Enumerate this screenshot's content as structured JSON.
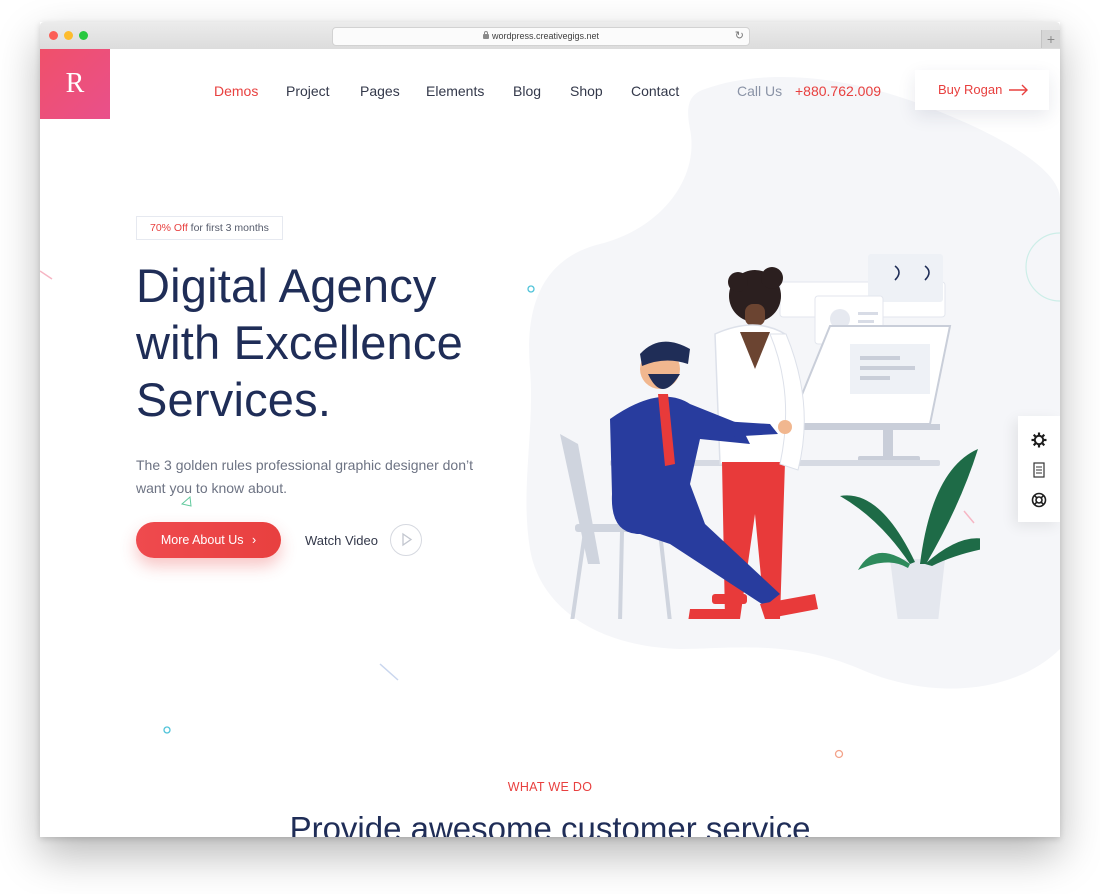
{
  "browser": {
    "url": "wordpress.creativegigs.net"
  },
  "header": {
    "logo_letter": "R",
    "nav": [
      {
        "label": "Demos",
        "active": true
      },
      {
        "label": "Project",
        "active": false
      },
      {
        "label": "Pages",
        "active": false
      },
      {
        "label": "Elements",
        "active": false
      },
      {
        "label": "Blog",
        "active": false
      },
      {
        "label": "Shop",
        "active": false
      },
      {
        "label": "Contact",
        "active": false
      }
    ],
    "call_label": "Call Us",
    "phone": "+880.762.009",
    "buy_label": "Buy Rogan"
  },
  "hero": {
    "badge_highlight": "70% Off",
    "badge_text": "for first 3 months",
    "headline_line1": "Digital Agency",
    "headline_line2": "with Excellence",
    "headline_line3": "Services.",
    "subtext": "The 3 golden rules professional graphic designer don’t want you to know about.",
    "cta_label": "More About Us",
    "video_label": "Watch Video"
  },
  "section": {
    "eyebrow": "WHAT WE DO",
    "title": "Provide awesome customer service"
  },
  "side_tools": [
    "gear-icon",
    "document-icon",
    "lifebuoy-icon"
  ],
  "colors": {
    "accent": "#e8403f",
    "navy": "#1f2d57",
    "logo_gradient_start": "#f0506a",
    "logo_gradient_end": "#e9508b"
  }
}
